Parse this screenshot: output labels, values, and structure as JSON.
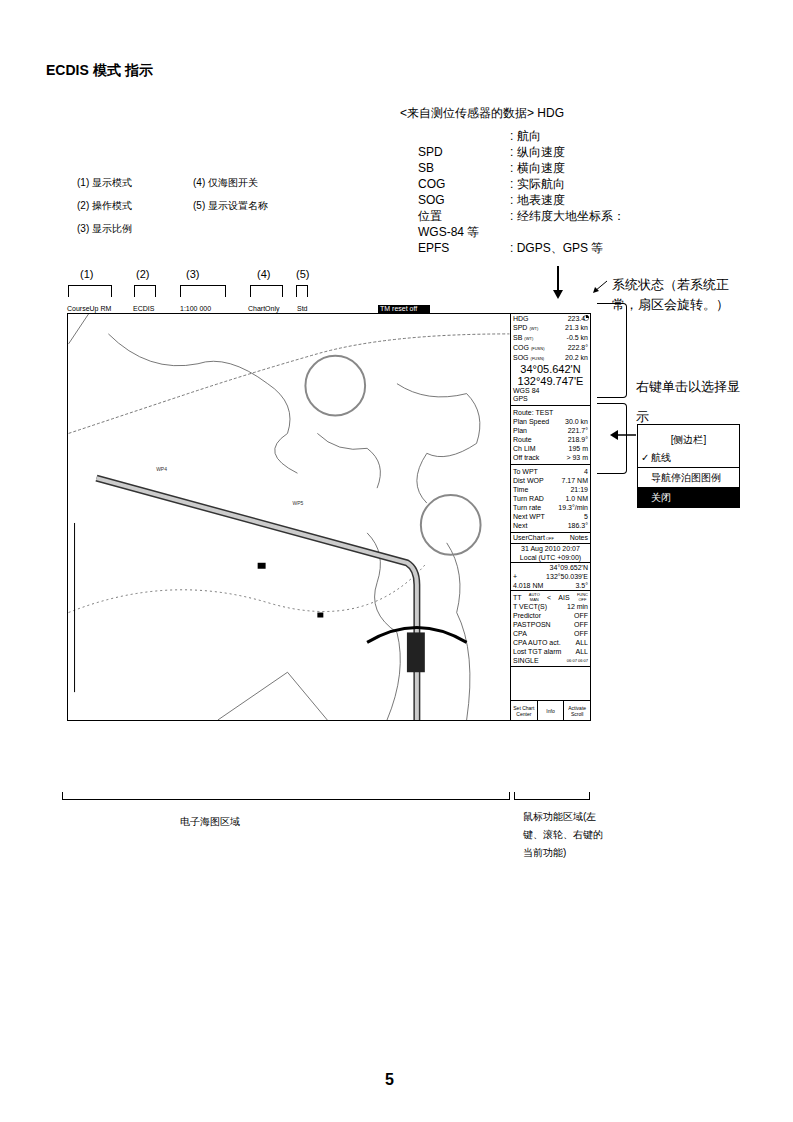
{
  "title": "ECDIS 模式 指示",
  "sensor_notes": {
    "header": "<来自测位传感器的数据> HDG",
    "rows": [
      {
        "key": "",
        "value": ": 航向"
      },
      {
        "key": "SPD",
        "value": ": 纵向速度"
      },
      {
        "key": "SB",
        "value": ": 横向速度"
      },
      {
        "key": "COG",
        "value": ": 实际航向"
      },
      {
        "key": "SOG",
        "value": ": 地表速度"
      },
      {
        "key": "位置",
        "value": ": 经纬度大地坐标系："
      },
      {
        "key": "WGS-84 等",
        "value": ""
      },
      {
        "key": "EPFS",
        "value": ": DGPS、GPS 等"
      }
    ]
  },
  "legend_columns": [
    [
      "(1) 显示模式",
      "(2) 操作模式",
      "(3) 显示比例"
    ],
    [
      "(4) 仅海图开关",
      "(5) 显示设置名称"
    ]
  ],
  "callout_numbers": [
    "(1)",
    "(2)",
    "(3)",
    "(4)",
    "(5)"
  ],
  "screen": {
    "top_bar": [
      "CourseUp RM",
      "ECDIS",
      "1:100 000",
      "ChartOnly",
      "Std"
    ],
    "status_badge": "TM reset off",
    "map_labels": [
      "WP4",
      "WP5"
    ],
    "sensor_rows": [
      {
        "label": "HDG",
        "tag": "",
        "value": "223.4°"
      },
      {
        "label": "SPD",
        "tag": "(WT)",
        "value": "21.3 kn"
      },
      {
        "label": "SB",
        "tag": "(WT)",
        "value": "-0.5 kn"
      },
      {
        "label": "COG",
        "tag": "(FUSN)",
        "value": "222.8°"
      },
      {
        "label": "SOG",
        "tag": "(FUSN)",
        "value": "20.2 kn"
      }
    ],
    "position": {
      "lat": "34°05.642'N",
      "lon": "132°49.747'E",
      "datum": "WGS 84",
      "epfs": "GPS"
    },
    "route_title": "Route: TEST",
    "route_rows": [
      {
        "label": "Plan Speed",
        "value": "30.0 kn"
      },
      {
        "label": "Plan",
        "value": "221.7°"
      },
      {
        "label": "Route",
        "value": "218.9°"
      },
      {
        "label": "Ch LIM",
        "value": "195 m"
      },
      {
        "label": "Off track",
        "value": ">   93 m"
      }
    ],
    "wpt_rows": [
      {
        "label": "To WPT",
        "value": "4"
      },
      {
        "label": "Dist WOP",
        "value": "7.17 NM"
      },
      {
        "label": "Time",
        "value": "21:19"
      },
      {
        "label": "Turn RAD",
        "value": "1.0 NM"
      },
      {
        "label": "Turn rate",
        "value": "19.3°/min"
      },
      {
        "label": "Next WPT",
        "value": "5"
      },
      {
        "label": "Next",
        "value": "186.3°"
      }
    ],
    "user_chart": {
      "label": "UserChart",
      "state": "OFF",
      "notes": "Notes"
    },
    "date": "31 Aug 2010 20:07",
    "local": "Local (UTC +09:00)",
    "cursor": {
      "prefix": "+",
      "lat": "34°09.652'N",
      "lon": "132°50.039'E",
      "range": "4.018 NM",
      "bearing": "3.5°"
    },
    "tt": {
      "label": "TT",
      "mode_top": "AUTO",
      "mode_bottom": "MAN",
      "arrow": "<",
      "source": "AIS",
      "func_top": "FUNC",
      "func_bottom": "OFF"
    },
    "tt_rows": [
      {
        "label": "T VECT(S)",
        "value": "12 min"
      },
      {
        "label": "Predictor",
        "value": "OFF"
      },
      {
        "label": "PASTPOSN",
        "value": "OFF"
      },
      {
        "label": "CPA",
        "value": "OFF"
      },
      {
        "label": "CPA AUTO act.",
        "value": "ALL"
      },
      {
        "label": "Lost TGT alarm",
        "value": "ALL"
      }
    ],
    "single": {
      "label": "SINGLE",
      "value": "06:07 06:07"
    },
    "buttons": [
      "Set Chart Center",
      "Info",
      "Activate Scroll"
    ]
  },
  "system_status": "系统状态（若系统正常，扇区会旋转。）",
  "right_click_hint": "右键单击以选择显示",
  "popup": {
    "title": "[侧边栏]",
    "check_mark": "✓",
    "items": [
      {
        "label": "航线",
        "checked": true,
        "selected": false
      },
      {
        "label": "导航停泊图图例",
        "checked": false,
        "selected": false
      },
      {
        "label": "关闭",
        "checked": false,
        "selected": true
      }
    ]
  },
  "chart_area_label": "电子海图区域",
  "mouse_area_label": "鼠标功能区域(左键、滚轮、右键的当前功能)",
  "page_number": "5"
}
